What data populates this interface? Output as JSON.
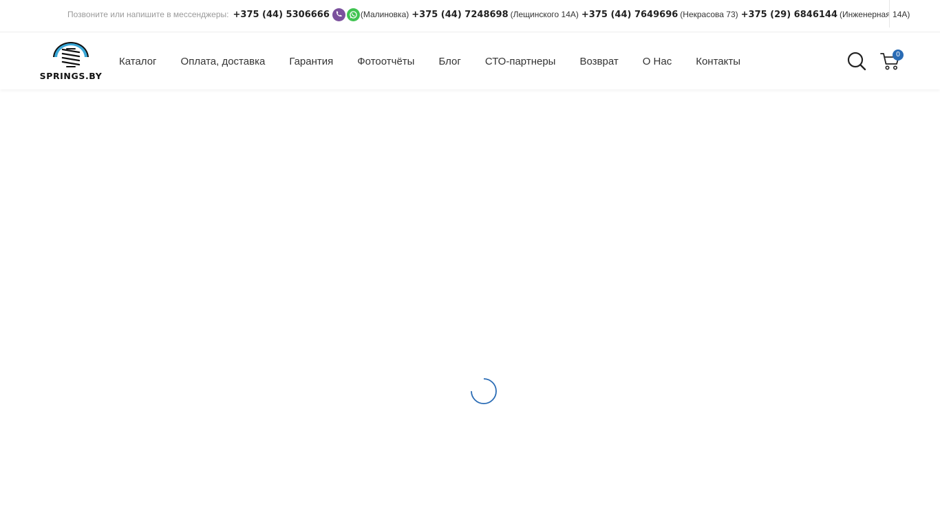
{
  "topbar": {
    "prompt": "Позвоните или напишите в мессенджеры:",
    "phones": [
      {
        "number": "+375 (44) 5306666",
        "location": "(Малиновка)"
      },
      {
        "number": "+375 (44) 7248698",
        "location": "(Лещинского 14А)"
      },
      {
        "number": "+375 (44) 7649696",
        "location": "(Некрасова 73)"
      },
      {
        "number": "+375 (29) 6846144",
        "location": "(Инженерная 14А)"
      }
    ],
    "messenger_icons": [
      "viber-icon",
      "whatsapp-icon"
    ]
  },
  "header": {
    "logo_text": "SPRINGS.BY",
    "nav": [
      "Каталог",
      "Оплата, доставка",
      "Гарантия",
      "Фотоотчёты",
      "Блог",
      "СТО-партнеры",
      "Возврат",
      "О Нас",
      "Контакты"
    ],
    "cart_count": "0"
  },
  "colors": {
    "accent": "#2a6cb5",
    "viber": "#7b519d",
    "whatsapp": "#3fc351",
    "logo_ring": "#3aa8d8"
  }
}
